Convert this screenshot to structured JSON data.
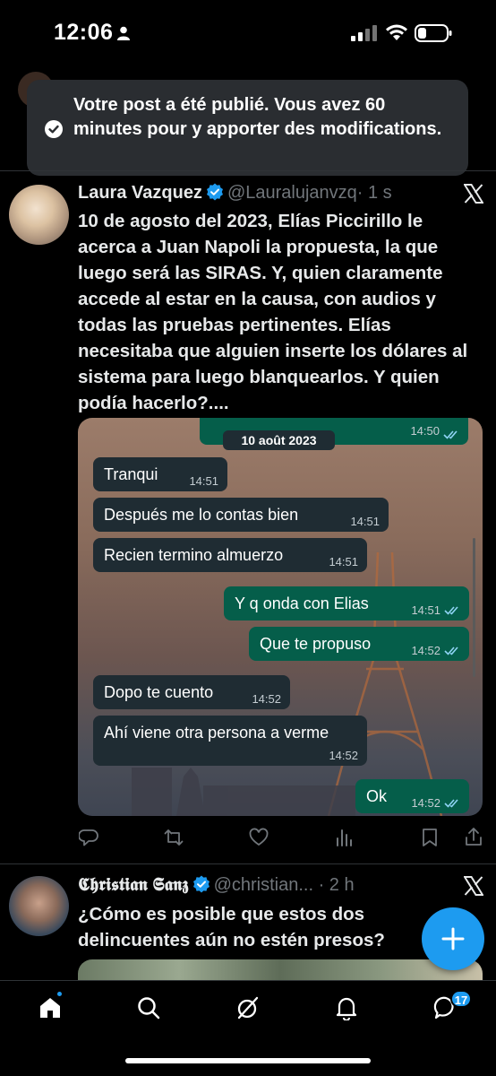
{
  "status_bar": {
    "time": "12:06"
  },
  "toast": {
    "message": "Votre post a été publié. Vous avez 60 minutes pour y apporter des modifications."
  },
  "tweet1": {
    "author": "Laura Vazquez",
    "handle": "@Lauralujanvzq",
    "time": "· 1 s",
    "text": "10 de agosto del 2023, Elías Piccirillo le acerca a Juan Napoli la propuesta, la que luego será las SIRAS. Y, quien claramente accede al estar en la causa, con audios y todas las pruebas pertinentes. Elías necesitaba que alguien inserte los dólares al sistema para luego blanquearlos. Y quien podía hacerlo?....",
    "chat": {
      "top_time": "14:50",
      "date": "10 août 2023",
      "messages": [
        {
          "dir": "in",
          "text": "Tranqui",
          "time": "14:51"
        },
        {
          "dir": "in",
          "text": "Después me lo contas bien",
          "time": "14:51"
        },
        {
          "dir": "in",
          "text": "Recien termino almuerzo",
          "time": "14:51"
        },
        {
          "dir": "out",
          "text": "Y q onda con Elias",
          "time": "14:51"
        },
        {
          "dir": "out",
          "text": "Que te propuso",
          "time": "14:52"
        },
        {
          "dir": "in",
          "text": "Dopo te cuento",
          "time": "14:52"
        },
        {
          "dir": "in",
          "text": "Ahí viene otra persona a verme",
          "time": "14:52"
        },
        {
          "dir": "out",
          "text": "Ok",
          "time": "14:52"
        }
      ]
    }
  },
  "tweet2": {
    "author": "𝕮𝖍𝖗𝖎𝖘𝖙𝖎𝖆𝖓 𝕾𝖆𝖓𝖟",
    "handle": "@christian...",
    "time": "· 2 h",
    "text": "¿Cómo es posible que estos dos delincuentes aún no estén presos?"
  },
  "icons": {
    "actions": [
      "reply-icon",
      "repost-icon",
      "like-icon",
      "views-icon",
      "bookmark-icon",
      "share-icon"
    ],
    "nav": [
      "home-icon",
      "search-icon",
      "grok-icon",
      "notifications-icon",
      "messages-icon"
    ]
  },
  "nav": {
    "messages_badge": "17"
  },
  "colors": {
    "accent": "#1d9bf0",
    "background": "#000000",
    "bubble_out": "#055e4a",
    "bubble_in": "#1f2c33"
  }
}
